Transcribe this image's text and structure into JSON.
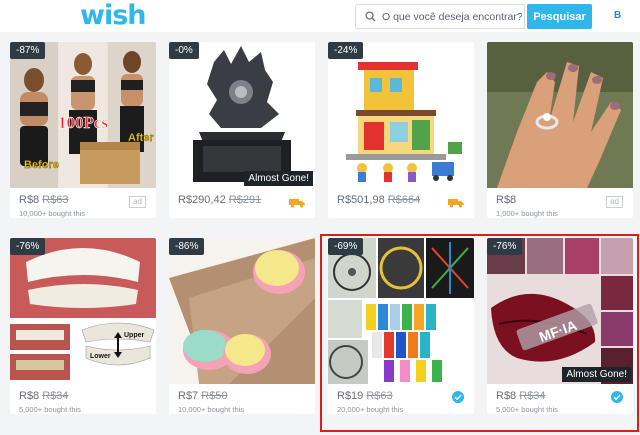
{
  "header": {
    "logo": "wish",
    "search_placeholder": "O que você deseja encontrar?",
    "search_button": "Pesquisar",
    "avatar_initial": "B"
  },
  "products": [
    {
      "discount": "-87%",
      "price": "R$8",
      "old_price": "R$63",
      "bought": "10,000+ bought this",
      "tag": "ad",
      "overlay_text_1": "100Pcs",
      "overlay_text_2": "Before",
      "overlay_text_3": "After"
    },
    {
      "discount": "-0%",
      "price": "R$290,42",
      "old_price": "R$291",
      "bought": "",
      "tag": "truck",
      "almost_gone": "Almost Gone!"
    },
    {
      "discount": "-24%",
      "price": "R$501,98",
      "old_price": "R$664",
      "bought": "",
      "tag": "truck"
    },
    {
      "discount": "",
      "price": "R$8",
      "old_price": "",
      "bought": "1,000+ bought this",
      "tag": "ad"
    },
    {
      "discount": "-76%",
      "price": "R$8",
      "old_price": "R$34",
      "bought": "5,000+ bought this",
      "tag": "",
      "overlay_text_1": "Upper",
      "overlay_text_2": "Lower"
    },
    {
      "discount": "-86%",
      "price": "R$7",
      "old_price": "R$50",
      "bought": "10,000+ bought this",
      "tag": ""
    },
    {
      "discount": "-69%",
      "price": "R$19",
      "old_price": "R$63",
      "bought": "20,000+ bought this",
      "tag": "verified"
    },
    {
      "discount": "-76%",
      "price": "R$8",
      "old_price": "R$34",
      "bought": "5,000+ bought this",
      "tag": "verified",
      "almost_gone": "Almost Gone!",
      "overlay_text_1": "MF·IA"
    }
  ],
  "colors": {
    "brand": "#2fb7ec",
    "badge": "#2e3a44",
    "highlight": "#d91e1e",
    "truck": "#f5a623",
    "verified": "#2fb7ec"
  }
}
